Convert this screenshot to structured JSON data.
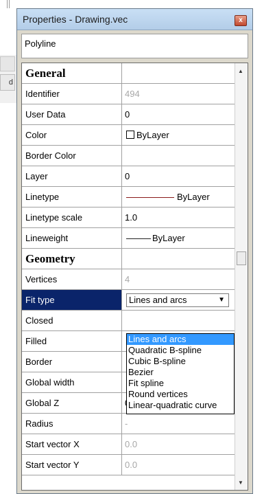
{
  "window": {
    "title": "Properties - Drawing.vec",
    "close_glyph": "x"
  },
  "object_type": "Polyline",
  "background": {
    "tab_glyph": "d"
  },
  "rows": [
    {
      "kind": "category",
      "name": "General",
      "value": ""
    },
    {
      "kind": "prop",
      "name": "Identifier",
      "value": "494",
      "disabled": true
    },
    {
      "kind": "prop",
      "name": "User Data",
      "value": "0"
    },
    {
      "kind": "prop",
      "name": "Color",
      "value": "ByLayer",
      "swatch": "#ffffff"
    },
    {
      "kind": "prop",
      "name": "Border Color",
      "value": ""
    },
    {
      "kind": "prop",
      "name": "Layer",
      "value": "0"
    },
    {
      "kind": "prop",
      "name": "Linetype",
      "value": "ByLayer",
      "line_color": "#8a1a1a"
    },
    {
      "kind": "prop",
      "name": "Linetype scale",
      "value": "1.0"
    },
    {
      "kind": "prop",
      "name": "Lineweight",
      "value": "ByLayer",
      "line_color": "#222222"
    },
    {
      "kind": "category",
      "name": "Geometry",
      "value": ""
    },
    {
      "kind": "prop",
      "name": "Vertices",
      "value": "4",
      "disabled": true
    },
    {
      "kind": "prop",
      "name": "Fit type",
      "value": "Lines and arcs",
      "selected": true
    },
    {
      "kind": "prop",
      "name": "Closed",
      "value": ""
    },
    {
      "kind": "prop",
      "name": "Filled",
      "value": ""
    },
    {
      "kind": "prop",
      "name": "Border",
      "value": ""
    },
    {
      "kind": "prop",
      "name": "Global width",
      "value": ""
    },
    {
      "kind": "prop",
      "name": "Global Z",
      "value": "0.0"
    },
    {
      "kind": "prop",
      "name": "Radius",
      "value": "-",
      "disabled": true
    },
    {
      "kind": "prop",
      "name": "Start vector X",
      "value": "0.0",
      "disabled": true
    },
    {
      "kind": "prop",
      "name": "Start vector Y",
      "value": "0.0",
      "disabled": true
    }
  ],
  "fit_type_dropdown": {
    "selected": "Lines and arcs",
    "options": [
      "Lines and arcs",
      "Quadratic B-spline",
      "Cubic B-spline",
      "Bezier",
      "Fit spline",
      "Round vertices",
      "Linear-quadratic curve"
    ]
  },
  "colors": {
    "selection": "#0a246a",
    "highlight": "#3399ff",
    "titlebar": "#b3cde8"
  }
}
